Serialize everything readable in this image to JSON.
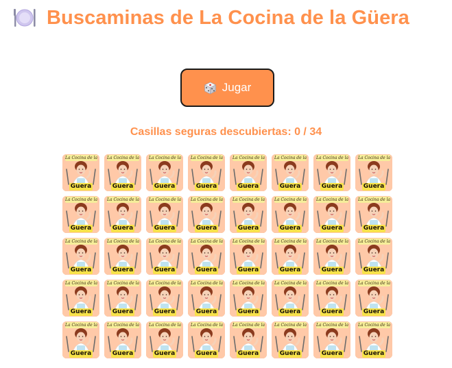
{
  "header": {
    "title": "Buscaminas de La Cocina de la Güera",
    "icon": "plate-with-cutlery-icon"
  },
  "controls": {
    "play_label": "Jugar",
    "play_icon": "dice-icon"
  },
  "status": {
    "text": "Casillas seguras descubiertas: 0 / 34",
    "revealed": 0,
    "safe_total": 34
  },
  "board": {
    "rows": 5,
    "columns": 8,
    "tile_label_top": "La Cocina de la",
    "tile_label_bottom": "Guera",
    "tile_state": "hidden"
  },
  "colors": {
    "accent": "#ff914d",
    "tile_background": "#ffc9a8",
    "logo_yellow": "#f7e24a"
  }
}
